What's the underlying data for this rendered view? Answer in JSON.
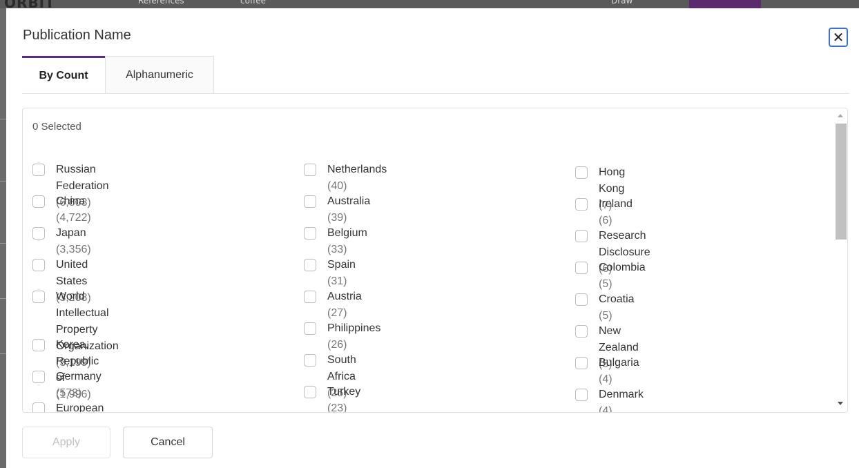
{
  "modal": {
    "title": "Publication Name",
    "close_label": "✕"
  },
  "tabs": [
    {
      "label": "By Count",
      "active": true
    },
    {
      "label": "Alphanumeric",
      "active": false
    }
  ],
  "selected_text": "0 Selected",
  "columns": [
    [
      {
        "name": "Russian Federation",
        "count": "(6,803)"
      },
      {
        "name": "China",
        "count": "(4,722)"
      },
      {
        "name": "Japan",
        "count": "(3,356)"
      },
      {
        "name": "United States",
        "count": "(3,208)"
      },
      {
        "name": "World Intellectual Property",
        "name2": "Organization",
        "count": "(3,199)"
      },
      {
        "name": "Korea, Republic of",
        "count": "(1,996)"
      },
      {
        "name": "Germany",
        "count": "(573)"
      },
      {
        "name": "European Patent Organization",
        "count": ""
      }
    ],
    [
      {
        "name": "Netherlands",
        "count": "(40)"
      },
      {
        "name": "Australia",
        "count": "(39)"
      },
      {
        "name": "Belgium",
        "count": "(33)"
      },
      {
        "name": "Spain",
        "count": "(31)"
      },
      {
        "name": "Austria",
        "count": "(27)"
      },
      {
        "name": "Philippines",
        "count": "(26)"
      },
      {
        "name": "South Africa",
        "count": "(25)"
      },
      {
        "name": "Turkey",
        "count": "(23)"
      }
    ],
    [
      {
        "name": "Hong Kong",
        "count": "(7)"
      },
      {
        "name": "Ireland",
        "count": "(6)"
      },
      {
        "name": "Research Disclosure",
        "count": "(6)"
      },
      {
        "name": "Colombia",
        "count": "(5)"
      },
      {
        "name": "Croatia",
        "count": "(5)"
      },
      {
        "name": "New Zealand",
        "count": "(5)"
      },
      {
        "name": "Bulgaria",
        "count": "(4)"
      },
      {
        "name": "Denmark",
        "count": "(4)"
      }
    ]
  ],
  "buttons": {
    "apply": "Apply",
    "cancel": "Cancel"
  },
  "background": {
    "brand": "ORBIT",
    "ref": "References",
    "coffee": "coffee",
    "draw": "Draw"
  },
  "colors": {
    "accent": "#5b2a86",
    "focus": "#3b6fd6"
  }
}
